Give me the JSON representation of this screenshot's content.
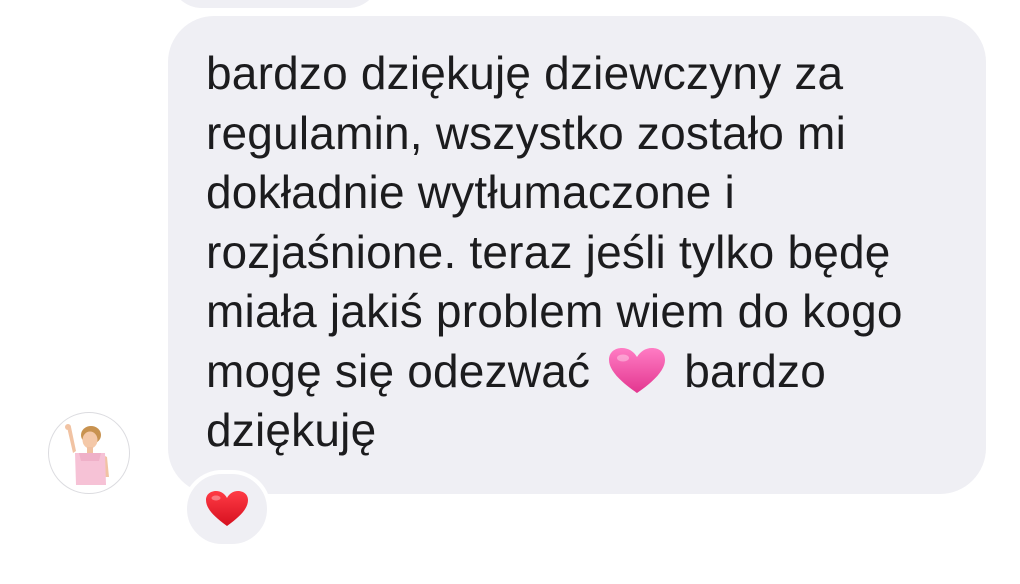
{
  "message": {
    "lines": [
      "bardzo dziękuję dziewczyny za",
      "regulamin, wszystko zostało mi",
      "dokładnie wytłumaczone i",
      "rozjaśnione. teraz jeśli tylko będę",
      "miała jakiś problem wiem do kogo"
    ],
    "line6_before_emoji": "mogę się odezwać",
    "line6_after_emoji": "bardzo",
    "line7": "dziękuję",
    "inline_emoji": "pink-heart-icon"
  },
  "reaction": {
    "emoji": "red-heart-icon"
  },
  "avatar": {
    "icon": "user-avatar"
  },
  "colors": {
    "bubble": "#efeff4",
    "text": "#1c1c1e",
    "pink_heart": "#f0569f",
    "red_heart": "#e2192c"
  }
}
